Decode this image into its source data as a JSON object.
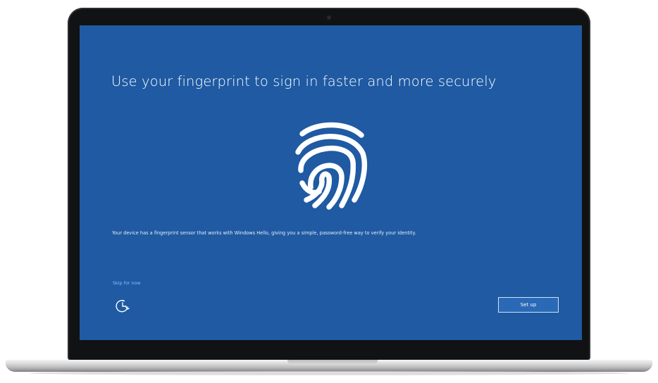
{
  "window": {
    "background_color": "#1f5aa3"
  },
  "setup": {
    "title": "Use your fingerprint to sign in faster and more securely",
    "description": "Your device has a fingerprint sensor that works with Windows Hello, giving you a simple, password-free way to verify your identity.",
    "skip_label": "Skip for now",
    "setup_button_label": "Set up",
    "accent_link_color": "#7fc4f4"
  },
  "icons": {
    "main": "fingerprint-icon",
    "accessibility": "ease-of-access-icon"
  }
}
